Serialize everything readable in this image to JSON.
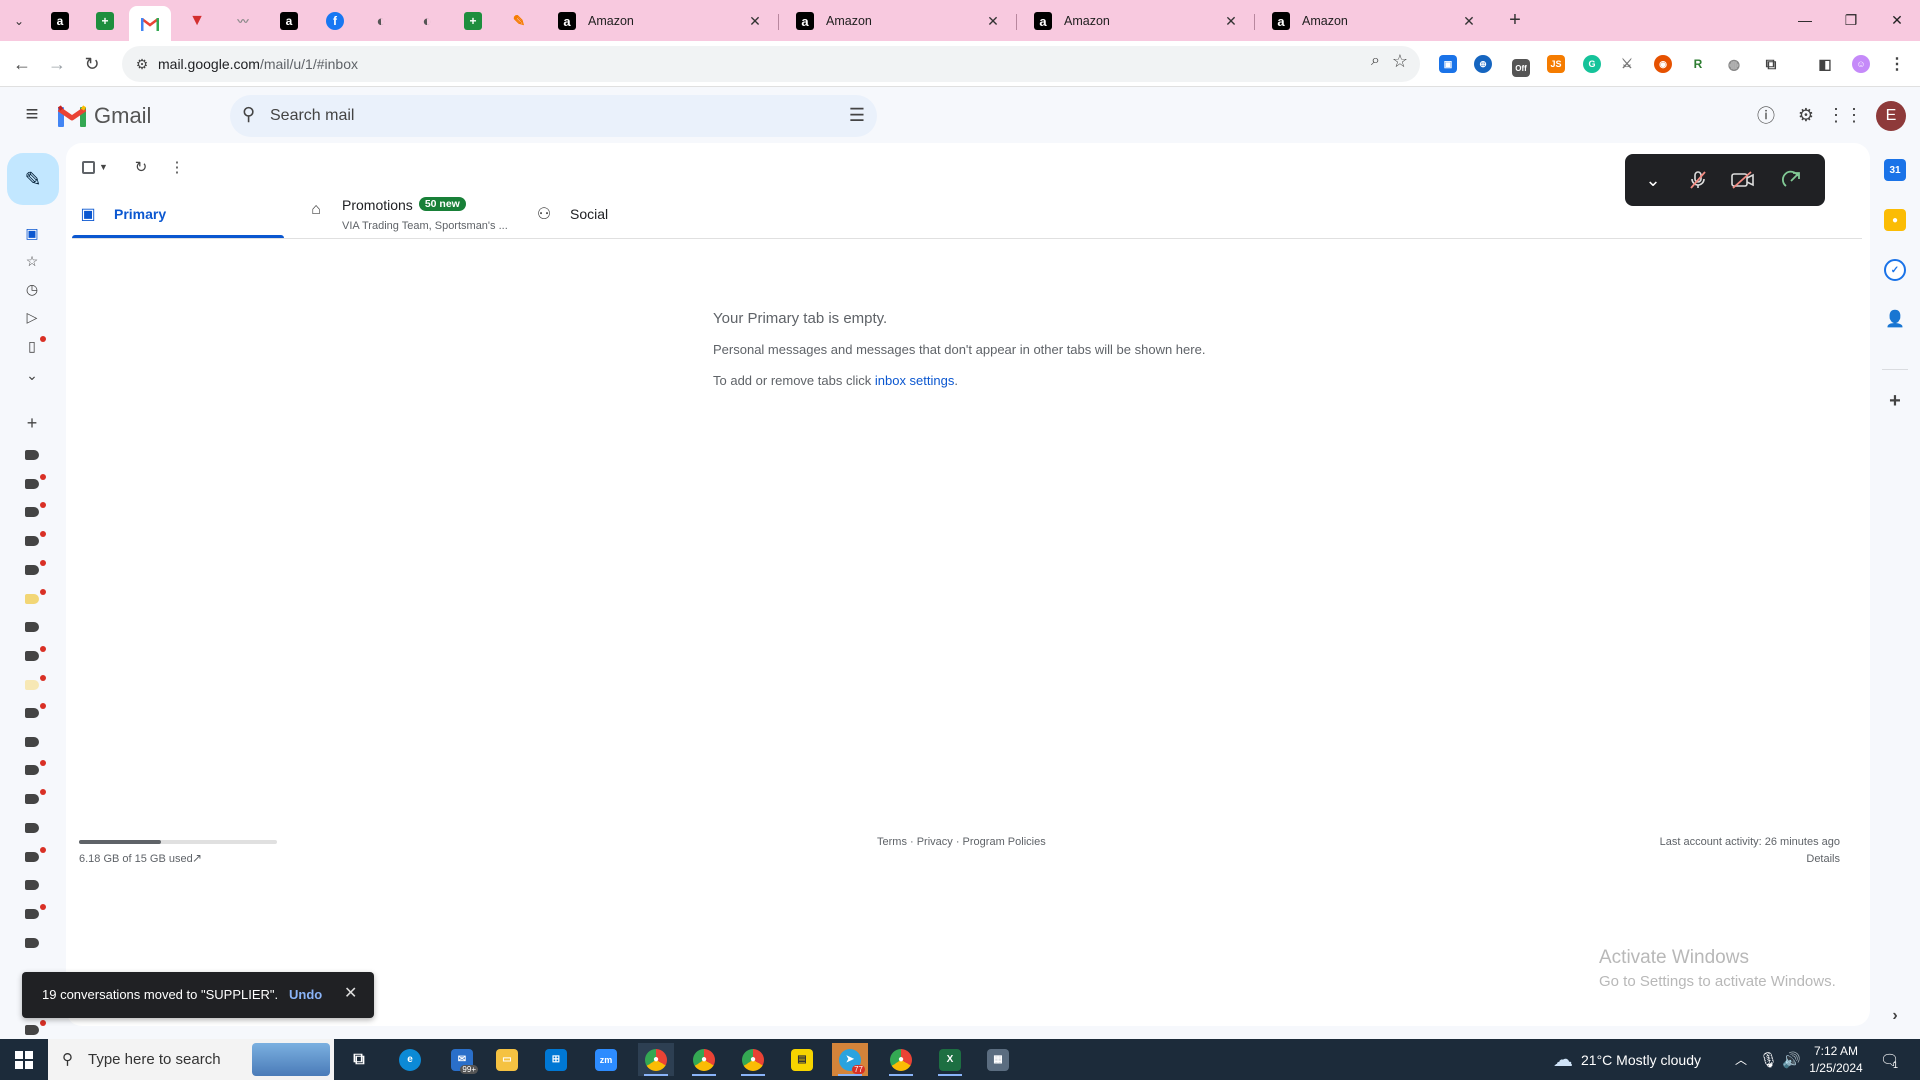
{
  "browser": {
    "tabs": [
      {
        "title": "Amazon",
        "close": "✕"
      },
      {
        "title": "Amazon",
        "close": "✕"
      },
      {
        "title": "Amazon",
        "close": "✕"
      },
      {
        "title": "Amazon",
        "close": "✕"
      }
    ],
    "url_host": "mail.google.com",
    "url_path": "/mail/u/1/#inbox"
  },
  "gmail": {
    "wordmark": "Gmail",
    "search_placeholder": "Search mail",
    "avatar_letter": "E"
  },
  "inbox_tabs": {
    "primary": "Primary",
    "promotions": "Promotions",
    "promotions_badge": "50 new",
    "promotions_sub": "VIA Trading Team, Sportsman's ...",
    "social": "Social"
  },
  "empty": {
    "title": "Your Primary tab is empty.",
    "line1": "Personal messages and messages that don't appear in other tabs will be shown here.",
    "line2_prefix": "To add or remove tabs click ",
    "line2_link": "inbox settings",
    "line2_suffix": "."
  },
  "footer": {
    "storage_text": "6.18 GB of 15 GB used",
    "storage_fraction": 0.412,
    "links": "Terms · Privacy · Program Policies",
    "last_activity": "Last account activity: 26 minutes ago",
    "details": "Details"
  },
  "watermark": {
    "line1": "Activate Windows",
    "line2": "Go to Settings to activate Windows."
  },
  "snackbar": {
    "message": "19 conversations moved to \"SUPPLIER\".",
    "undo": "Undo"
  },
  "taskbar": {
    "search_placeholder": "Type here to search",
    "mail_badge": "99+",
    "telegram_badge": "77",
    "weather": "21°C  Mostly cloudy",
    "time": "7:12 AM",
    "date": "1/25/2024",
    "notification_count": "1"
  },
  "colors": {
    "tabstrip": "#f8c9df",
    "accent": "#0b57d0",
    "compose": "#c2e7ff",
    "promo_badge": "#188038"
  }
}
